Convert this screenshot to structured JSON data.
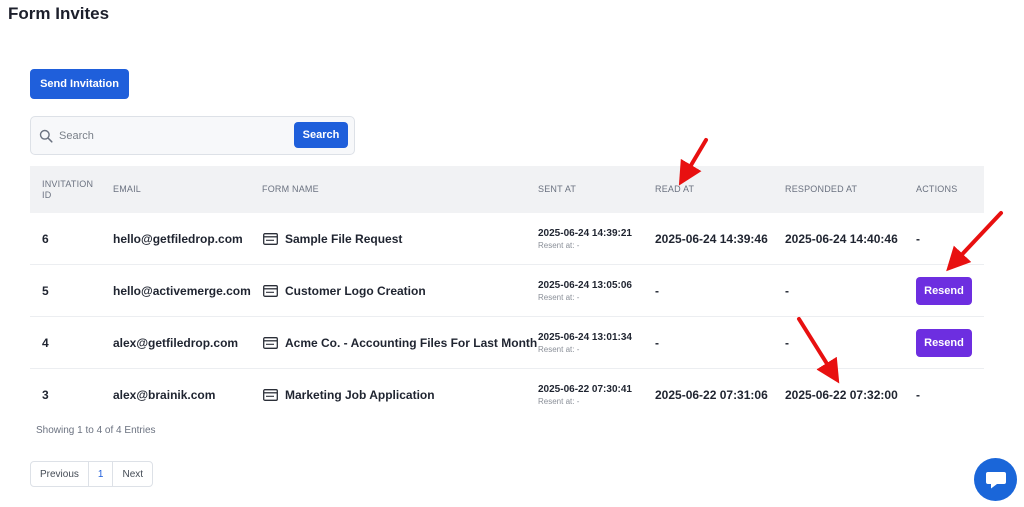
{
  "page": {
    "title": "Form Invites"
  },
  "toolbar": {
    "send_label": "Send Invitation"
  },
  "search": {
    "placeholder": "Search",
    "button_label": "Search"
  },
  "table": {
    "headers": {
      "id": "INVITATION ID",
      "email": "EMAIL",
      "form": "FORM NAME",
      "sent": "SENT AT",
      "read": "READ AT",
      "responded": "RESPONDED AT",
      "actions": "ACTIONS"
    },
    "rows": [
      {
        "id": "6",
        "email": "hello@getfiledrop.com",
        "form": "Sample File Request",
        "sent": "2025-06-24 14:39:21",
        "resent": "Resent at: -",
        "read": "2025-06-24 14:39:46",
        "responded": "2025-06-24 14:40:46",
        "action": "-"
      },
      {
        "id": "5",
        "email": "hello@activemerge.com",
        "form": "Customer Logo Creation",
        "sent": "2025-06-24 13:05:06",
        "resent": "Resent at: -",
        "read": "-",
        "responded": "-",
        "action": "Resend"
      },
      {
        "id": "4",
        "email": "alex@getfiledrop.com",
        "form": "Acme Co. - Accounting Files For Last Month",
        "sent": "2025-06-24 13:01:34",
        "resent": "Resent at: -",
        "read": "-",
        "responded": "-",
        "action": "Resend"
      },
      {
        "id": "3",
        "email": "alex@brainik.com",
        "form": "Marketing Job Application",
        "sent": "2025-06-22 07:30:41",
        "resent": "Resent at: -",
        "read": "2025-06-22 07:31:06",
        "responded": "2025-06-22 07:32:00",
        "action": "-"
      }
    ]
  },
  "footer": {
    "entries_text": "Showing 1 to 4 of 4 Entries"
  },
  "pagination": {
    "previous": "Previous",
    "current": "1",
    "next": "Next"
  },
  "colors": {
    "primary": "#1f5fdb",
    "resend": "#6d2ee0",
    "annotation": "#e81010"
  },
  "icons": {
    "search": "search-icon",
    "form": "form-icon",
    "chat": "chat-icon",
    "annotation": "red-arrow-icon"
  }
}
